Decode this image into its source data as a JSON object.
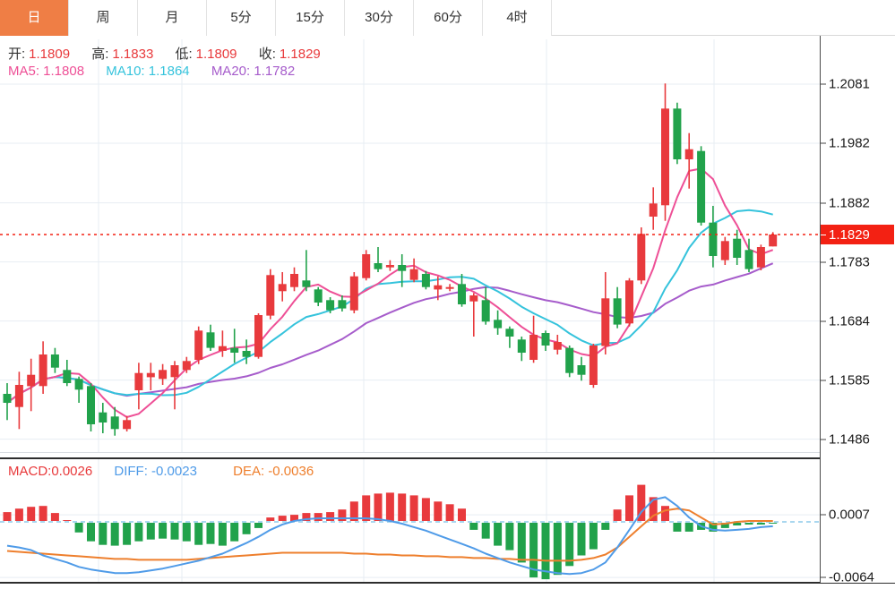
{
  "tabs": [
    {
      "label": "日",
      "active": true
    },
    {
      "label": "周",
      "active": false
    },
    {
      "label": "月",
      "active": false
    },
    {
      "label": "5分",
      "active": false
    },
    {
      "label": "15分",
      "active": false
    },
    {
      "label": "30分",
      "active": false
    },
    {
      "label": "60分",
      "active": false
    },
    {
      "label": "4时",
      "active": false
    }
  ],
  "ohlc": {
    "o_label": "开:",
    "o": "1.1809",
    "h_label": "高:",
    "h": "1.1833",
    "l_label": "低:",
    "l": "1.1809",
    "c_label": "收:",
    "c": "1.1829"
  },
  "ma": {
    "ma5": "MA5: 1.1808",
    "ma10": "MA10: 1.1864",
    "ma20": "MA20: 1.1782"
  },
  "macd_header": {
    "macd": "MACD:0.0026",
    "diff": "DIFF: -0.0023",
    "dea": "DEA: -0.0036"
  },
  "last_price_label": "1.1829",
  "colors": {
    "accent_orange": "#ef7e45",
    "up_red": "#e83a3d",
    "down_green": "#21a24b",
    "ma5_pink": "#ee4f96",
    "ma10_cyan": "#35c3dc",
    "ma20_purple": "#a65ccb",
    "diff_blue": "#4f9be8",
    "dea_orange": "#ee7f2d",
    "last_price_red": "#f32113",
    "grid": "#e7edf3",
    "header_value_red": "#e8393b"
  },
  "chart_data": {
    "type": "candlestick",
    "panels": [
      {
        "name": "price",
        "y_ticks": [
          1.2081,
          1.1982,
          1.1882,
          1.1783,
          1.1684,
          1.1585,
          1.1486
        ],
        "last_price": 1.1829,
        "ma_periods": [
          5,
          10,
          20
        ],
        "candles": [
          [
            1.1562,
            1.158,
            1.1518,
            1.1547
          ],
          [
            1.154,
            1.1599,
            1.1503,
            1.1577
          ],
          [
            1.1575,
            1.1621,
            1.1533,
            1.1594
          ],
          [
            1.1575,
            1.165,
            1.1562,
            1.1628
          ],
          [
            1.1628,
            1.1639,
            1.1597,
            1.1606
          ],
          [
            1.1602,
            1.1619,
            1.1575,
            1.158
          ],
          [
            1.1587,
            1.1591,
            1.1547,
            1.1569
          ],
          [
            1.1575,
            1.158,
            1.1499,
            1.1511
          ],
          [
            1.1531,
            1.1547,
            1.1496,
            1.1514
          ],
          [
            1.1524,
            1.154,
            1.1492,
            1.1503
          ],
          [
            1.1503,
            1.1525,
            1.1499,
            1.1518
          ],
          [
            1.1568,
            1.1614,
            1.1536,
            1.1597
          ],
          [
            1.159,
            1.1614,
            1.1568,
            1.1597
          ],
          [
            1.1587,
            1.1612,
            1.1577,
            1.1602
          ],
          [
            1.159,
            1.1617,
            1.1536,
            1.161
          ],
          [
            1.1602,
            1.1624,
            1.1597,
            1.1617
          ],
          [
            1.1619,
            1.1675,
            1.1612,
            1.1668
          ],
          [
            1.1665,
            1.1678,
            1.1634,
            1.1639
          ],
          [
            1.1634,
            1.1668,
            1.1624,
            1.1642
          ],
          [
            1.1639,
            1.1671,
            1.1614,
            1.1631
          ],
          [
            1.1634,
            1.1653,
            1.1612,
            1.1624
          ],
          [
            1.1624,
            1.1697,
            1.1621,
            1.1694
          ],
          [
            1.1693,
            1.1771,
            1.1687,
            1.1761
          ],
          [
            1.1734,
            1.1766,
            1.1717,
            1.1746
          ],
          [
            1.1741,
            1.1774,
            1.1734,
            1.1763
          ],
          [
            1.1752,
            1.1803,
            1.1734,
            1.1741
          ],
          [
            1.1737,
            1.1741,
            1.1709,
            1.1715
          ],
          [
            1.1719,
            1.1724,
            1.1697,
            1.1702
          ],
          [
            1.1719,
            1.1727,
            1.17,
            1.1705
          ],
          [
            1.1702,
            1.1766,
            1.1697,
            1.1759
          ],
          [
            1.1756,
            1.1803,
            1.1752,
            1.1796
          ],
          [
            1.1781,
            1.1808,
            1.1766,
            1.1771
          ],
          [
            1.1774,
            1.1786,
            1.1768,
            1.1778
          ],
          [
            1.1778,
            1.1796,
            1.1741,
            1.1768
          ],
          [
            1.1753,
            1.1789,
            1.1749,
            1.1771
          ],
          [
            1.1763,
            1.1768,
            1.1737,
            1.1741
          ],
          [
            1.1737,
            1.1759,
            1.1719,
            1.1744
          ],
          [
            1.1738,
            1.1746,
            1.1734,
            1.1741
          ],
          [
            1.1746,
            1.1763,
            1.1708,
            1.1712
          ],
          [
            1.1717,
            1.1731,
            1.1658,
            1.1727
          ],
          [
            1.1719,
            1.1741,
            1.1678,
            1.1683
          ],
          [
            1.1686,
            1.1702,
            1.1661,
            1.1672
          ],
          [
            1.1671,
            1.1675,
            1.1639,
            1.1658
          ],
          [
            1.1653,
            1.1658,
            1.1617,
            1.1631
          ],
          [
            1.1619,
            1.1693,
            1.1614,
            1.1661
          ],
          [
            1.1664,
            1.1668,
            1.1634,
            1.1643
          ],
          [
            1.1636,
            1.1661,
            1.1628,
            1.1649
          ],
          [
            1.1639,
            1.1643,
            1.159,
            1.1597
          ],
          [
            1.161,
            1.1624,
            1.1584,
            1.1594
          ],
          [
            1.1577,
            1.1646,
            1.1572,
            1.1643
          ],
          [
            1.1642,
            1.1766,
            1.1628,
            1.1722
          ],
          [
            1.1722,
            1.1741,
            1.1672,
            1.1678
          ],
          [
            1.168,
            1.1756,
            1.1675,
            1.1752
          ],
          [
            1.1752,
            1.1841,
            1.1746,
            1.183
          ],
          [
            1.1859,
            1.1908,
            1.1837,
            1.1881
          ],
          [
            1.1878,
            1.2082,
            1.1852,
            1.204
          ],
          [
            1.204,
            1.205,
            1.1947,
            1.1955
          ],
          [
            1.1955,
            1.1999,
            1.1906,
            1.1972
          ],
          [
            1.1969,
            1.1977,
            1.1844,
            1.1849
          ],
          [
            1.1849,
            1.1877,
            1.1774,
            1.1793
          ],
          [
            1.1786,
            1.1825,
            1.1778,
            1.1818
          ],
          [
            1.1822,
            1.1837,
            1.1778,
            1.179
          ],
          [
            1.1803,
            1.1822,
            1.1766,
            1.1771
          ],
          [
            1.1774,
            1.1812,
            1.1769,
            1.1808
          ],
          [
            1.1809,
            1.1833,
            1.1809,
            1.1829
          ]
        ]
      },
      {
        "name": "macd",
        "y_ticks": [
          0.0007,
          -0.0064
        ],
        "hist": [
          0.001,
          0.0014,
          0.0016,
          0.0017,
          0.0009,
          0.0001,
          -0.0011,
          -0.0021,
          -0.0025,
          -0.0026,
          -0.0025,
          -0.0021,
          -0.0019,
          -0.0018,
          -0.0019,
          -0.0021,
          -0.0025,
          -0.0024,
          -0.0026,
          -0.0021,
          -0.0013,
          -0.0006,
          0.0004,
          0.0006,
          0.0007,
          0.0009,
          0.0009,
          0.001,
          0.0013,
          0.0022,
          0.0029,
          0.0031,
          0.0032,
          0.0031,
          0.0029,
          0.0026,
          0.0022,
          0.0019,
          0.0014,
          -0.0008,
          -0.0018,
          -0.0026,
          -0.0031,
          -0.0045,
          -0.0062,
          -0.0064,
          -0.0059,
          -0.0049,
          -0.0037,
          -0.003,
          -0.0008,
          0.0013,
          0.0029,
          0.0041,
          0.0027,
          0.0017,
          -0.001,
          -0.001,
          -0.0008,
          -0.001,
          -0.0006,
          -0.0003,
          -0.0002,
          -0.0002,
          -0.0001
        ],
        "diff": [
          -0.0028,
          -0.003,
          -0.0033,
          -0.0039,
          -0.0043,
          -0.0047,
          -0.0052,
          -0.0055,
          -0.0057,
          -0.0059,
          -0.0059,
          -0.0058,
          -0.0056,
          -0.0054,
          -0.0051,
          -0.0048,
          -0.0045,
          -0.0041,
          -0.0037,
          -0.0031,
          -0.0025,
          -0.0018,
          -0.001,
          -0.0004,
          0.0,
          0.0002,
          0.0003,
          0.0003,
          0.0003,
          0.0003,
          0.0003,
          0.0002,
          0.0,
          -0.0003,
          -0.0007,
          -0.0011,
          -0.0016,
          -0.0021,
          -0.0026,
          -0.0031,
          -0.0037,
          -0.0042,
          -0.0047,
          -0.0051,
          -0.0055,
          -0.0057,
          -0.0059,
          -0.006,
          -0.0059,
          -0.0055,
          -0.0047,
          -0.003,
          -0.001,
          0.001,
          0.0024,
          0.0027,
          0.0017,
          0.0004,
          -0.0006,
          -0.001,
          -0.0011,
          -0.001,
          -0.0009,
          -0.0007,
          -0.0006
        ],
        "dea": [
          -0.0034,
          -0.0035,
          -0.0036,
          -0.0037,
          -0.0038,
          -0.0039,
          -0.004,
          -0.0041,
          -0.0042,
          -0.0043,
          -0.0043,
          -0.0044,
          -0.0044,
          -0.0044,
          -0.0044,
          -0.0044,
          -0.0043,
          -0.0042,
          -0.0041,
          -0.004,
          -0.0039,
          -0.0038,
          -0.0037,
          -0.0036,
          -0.0036,
          -0.0036,
          -0.0036,
          -0.0036,
          -0.0036,
          -0.0037,
          -0.0037,
          -0.0038,
          -0.0038,
          -0.0039,
          -0.0039,
          -0.004,
          -0.004,
          -0.0041,
          -0.0041,
          -0.0042,
          -0.0042,
          -0.0043,
          -0.0043,
          -0.0044,
          -0.0044,
          -0.0045,
          -0.0045,
          -0.0045,
          -0.0044,
          -0.0042,
          -0.0038,
          -0.003,
          -0.0018,
          -0.0006,
          0.0006,
          0.0012,
          0.0014,
          0.0012,
          0.0004,
          -0.0004,
          -0.0003,
          -0.0001,
          0.0,
          0.0,
          0.0
        ]
      }
    ]
  }
}
